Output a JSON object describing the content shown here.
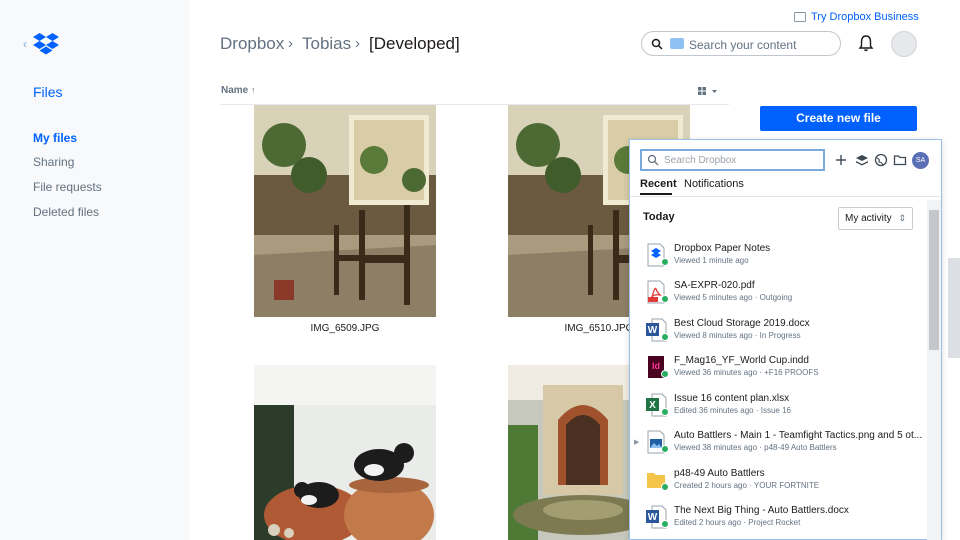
{
  "sidebar": {
    "title": "Files",
    "items": [
      {
        "label": "My files"
      },
      {
        "label": "Sharing"
      },
      {
        "label": "File requests"
      },
      {
        "label": "Deleted files"
      }
    ]
  },
  "header": {
    "breadcrumb": [
      "Dropbox",
      "Tobias",
      "[Developed]"
    ],
    "search_placeholder": "Search your content",
    "try_business": "Try Dropbox Business"
  },
  "list": {
    "name_header": "Name",
    "sort_arrow": "↑",
    "photos": [
      {
        "caption": "IMG_6509.JPG"
      },
      {
        "caption": "IMG_6510.JPG"
      },
      {
        "caption": ""
      },
      {
        "caption": ""
      }
    ]
  },
  "actions": {
    "create_new_file": "Create new file"
  },
  "popup": {
    "search_placeholder": "Search Dropbox",
    "avatar_initials": "SA",
    "tabs": [
      {
        "label": "Recent"
      },
      {
        "label": "Notifications"
      }
    ],
    "section": "Today",
    "filter": "My activity",
    "items": [
      {
        "name": "Dropbox Paper Notes",
        "meta": "Viewed 1 minute ago",
        "icon": "paper-icon"
      },
      {
        "name": "SA-EXPR-020.pdf",
        "meta": "Viewed 5 minutes ago · Outgoing",
        "icon": "pdf-icon"
      },
      {
        "name": "Best Cloud Storage 2019.docx",
        "meta": "Viewed 8 minutes ago · In Progress",
        "icon": "word-icon"
      },
      {
        "name": "F_Mag16_YF_World Cup.indd",
        "meta": "Viewed 36 minutes ago · +F16 PROOFS",
        "icon": "indesign-icon"
      },
      {
        "name": "Issue 16 content plan.xlsx",
        "meta": "Edited 36 minutes ago · Issue 16",
        "icon": "excel-icon"
      },
      {
        "name": "Auto Battlers - Main 1 - Teamfight Tactics.png and 5 ot...",
        "meta": "Viewed 38 minutes ago · p48-49 Auto Battlers",
        "icon": "image-icon"
      },
      {
        "name": "p48-49 Auto Battlers",
        "meta": "Created 2 hours ago · YOUR FORTNITE",
        "icon": "folder-icon"
      },
      {
        "name": "The Next Big Thing - Auto Battlers.docx",
        "meta": "Edited 2 hours ago · Project Rocket",
        "icon": "word-icon"
      }
    ]
  },
  "colors": {
    "accent": "#0061fe",
    "success": "#27ae60"
  }
}
